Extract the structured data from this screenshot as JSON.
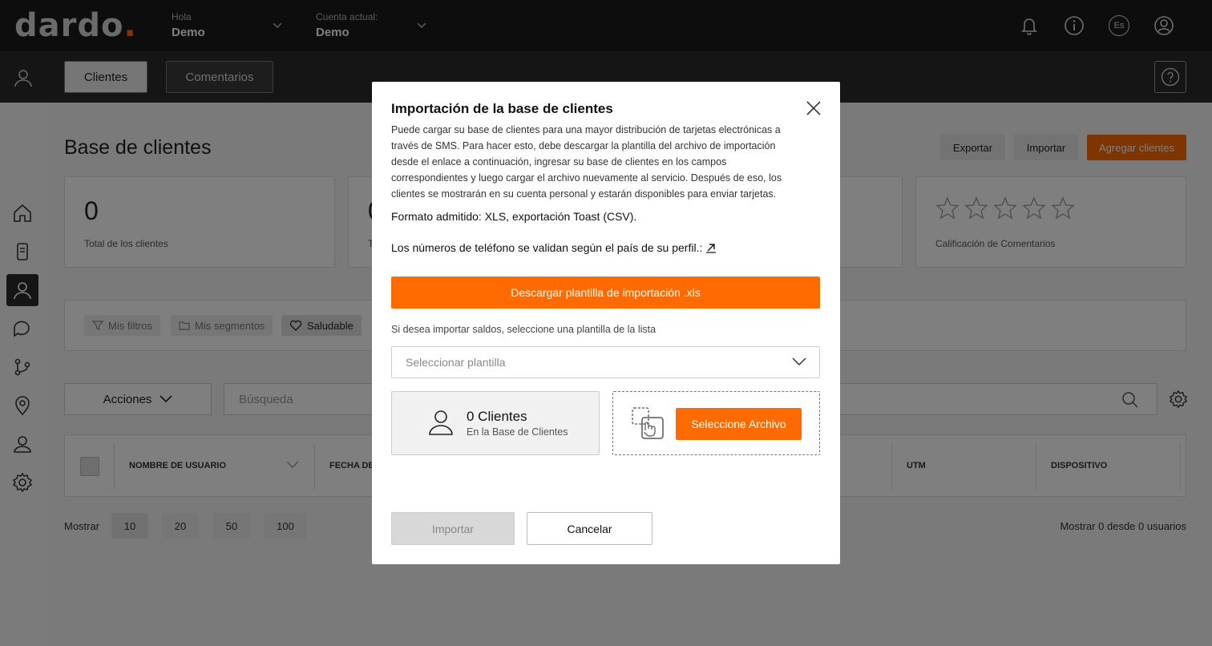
{
  "topbar": {
    "logo_text": "dardo",
    "logo_dot": ".",
    "greeting_label": "Hola",
    "greeting_value": "Demo",
    "account_label": "Cuenta actual:",
    "account_value": "Demo",
    "language_code": "Es",
    "icons": [
      "bell-icon",
      "info-icon",
      "language-icon",
      "user-circle-icon"
    ]
  },
  "subbar": {
    "tabs": [
      {
        "label": "Clientes",
        "active": true
      },
      {
        "label": "Comentarios",
        "active": false
      }
    ],
    "help_icon": "help-icon"
  },
  "sidebar": {
    "items": [
      "home-icon",
      "device-icon",
      "clients-icon",
      "comments-icon",
      "flow-icon",
      "location-icon",
      "profile-icon",
      "settings-icon"
    ],
    "active": "clients-icon"
  },
  "page": {
    "title": "Base de clientes",
    "export_label": "Exportar",
    "import_label": "Importar",
    "add_label": "Agregar clientes",
    "accent": "#ff6b00"
  },
  "cards": [
    {
      "value": "0",
      "label": "Total de los clientes"
    },
    {
      "value": "0",
      "label": "T"
    },
    {
      "label": "Calificación de Comentarios",
      "stars": 0
    }
  ],
  "filters": {
    "my_filters": "Mis filtros",
    "my_segments": "Mis segmentos",
    "healthy": "Saludable"
  },
  "toolbar": {
    "actions_label": "Acciones",
    "search_placeholder": "Búsqueda"
  },
  "table": {
    "columns": [
      "NOMBRE DE USUARIO",
      "FECHA DE",
      "UTM",
      "DISPOSITIVO"
    ]
  },
  "pagination": {
    "show_label": "Mostrar",
    "sizes": [
      "10",
      "20",
      "50",
      "100"
    ],
    "selected": "10",
    "summary": "Mostrar 0 desde 0 usuarios"
  },
  "modal": {
    "title": "Importación de la base de clientes",
    "description": "Puede cargar su base de clientes para una mayor distribución de tarjetas electrónicas a través de SMS. Para hacer esto, debe descargar la plantilla del archivo de importación desde el enlace a continuación, ingresar su base de clientes en los campos correspondientes y luego cargar el archivo nuevamente al servicio. Después de eso, los clientes se mostrarán en su cuenta personal y estarán disponibles para enviar tarjetas.",
    "format_text": "Formato admitido: XLS, exportación Toast (CSV).",
    "phone_text": "Los números de teléfono se validan según el país de su perfil.:",
    "download_label": "Descargar plantilla de importación .xls",
    "balance_hint": "Si desea importar saldos, seleccione una plantilla de la lista",
    "select_placeholder": "Seleccionar plantilla",
    "clients_count": "0 Clientes",
    "clients_sub": "En la Base de Clientes",
    "select_file_label": "Seleccione Archivo",
    "import_label": "Importar",
    "cancel_label": "Cancelar"
  }
}
